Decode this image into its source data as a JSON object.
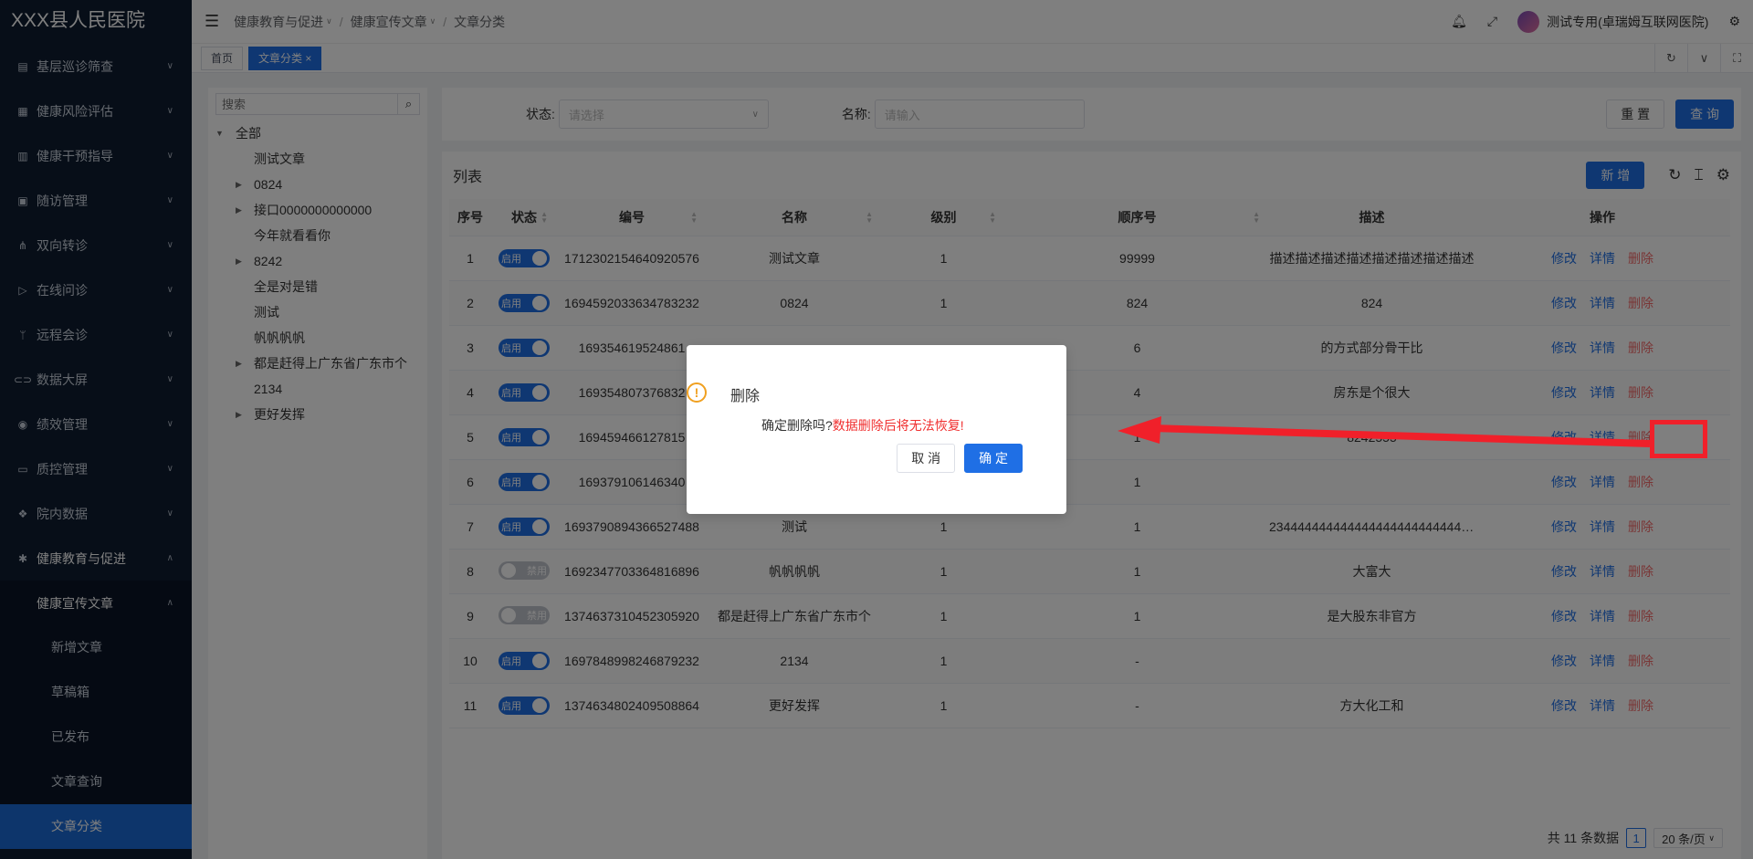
{
  "app": {
    "title": "XXX县人民医院"
  },
  "sidebar": {
    "items": [
      {
        "label": "基层巡诊筛查",
        "icon": "clipboard-icon"
      },
      {
        "label": "健康风险评估",
        "icon": "report-icon"
      },
      {
        "label": "健康干预指导",
        "icon": "grid-icon"
      },
      {
        "label": "随访管理",
        "icon": "calendar-icon"
      },
      {
        "label": "双向转诊",
        "icon": "network-icon"
      },
      {
        "label": "在线问诊",
        "icon": "send-icon"
      },
      {
        "label": "远程会诊",
        "icon": "branch-icon"
      },
      {
        "label": "数据大屏",
        "icon": "link-icon"
      },
      {
        "label": "绩效管理",
        "icon": "circle-icon"
      },
      {
        "label": "质控管理",
        "icon": "monitor-icon"
      },
      {
        "label": "院内数据",
        "icon": "dropbox-icon"
      },
      {
        "label": "健康教育与促进",
        "icon": "dots-icon"
      }
    ],
    "sub_parent": "健康宣传文章",
    "sub_items": [
      "新增文章",
      "草稿箱",
      "已发布",
      "文章查询",
      "文章分类"
    ]
  },
  "header": {
    "breadcrumb": [
      "健康教育与促进",
      "健康宣传文章",
      "文章分类"
    ],
    "user": "测试专用(卓瑞姆互联网医院)"
  },
  "tabs": [
    "首页",
    "文章分类"
  ],
  "tree": {
    "placeholder": "搜索",
    "root": "全部",
    "nodes": [
      {
        "label": "测试文章",
        "expandable": false
      },
      {
        "label": "0824",
        "expandable": true
      },
      {
        "label": "接口0000000000000",
        "expandable": true
      },
      {
        "label": "今年就看看你",
        "expandable": false
      },
      {
        "label": "8242",
        "expandable": true
      },
      {
        "label": "全是对是错",
        "expandable": false
      },
      {
        "label": "测试",
        "expandable": false
      },
      {
        "label": "帆帆帆帆",
        "expandable": false
      },
      {
        "label": "都是赶得上广东省广东市个",
        "expandable": true
      },
      {
        "label": "2134",
        "expandable": false
      },
      {
        "label": "更好发挥",
        "expandable": true
      }
    ]
  },
  "search": {
    "status_label": "状态:",
    "status_placeholder": "请选择",
    "name_label": "名称:",
    "name_placeholder": "请输入",
    "reset": "重 置",
    "query": "查 询"
  },
  "table": {
    "title": "列表",
    "add": "新 增",
    "columns": [
      "序号",
      "状态",
      "编号",
      "名称",
      "级别",
      "顺序号",
      "描述",
      "操作"
    ],
    "status_on": "启用",
    "status_off": "禁用",
    "actions": [
      "修改",
      "详情",
      "删除"
    ],
    "rows": [
      {
        "no": "1",
        "on": true,
        "code": "1712302154640920576",
        "name": "测试文章",
        "level": "1",
        "order": "99999",
        "desc": "描述描述描述描述描述描述描述描述"
      },
      {
        "no": "2",
        "on": true,
        "code": "1694592033634783232",
        "name": "0824",
        "level": "1",
        "order": "824",
        "desc": "824"
      },
      {
        "no": "3",
        "on": true,
        "code": "169354619524861",
        "name": "",
        "level": "",
        "order": "6",
        "desc": "的方式部分骨干比"
      },
      {
        "no": "4",
        "on": true,
        "code": "169354807376832",
        "name": "",
        "level": "",
        "order": "4",
        "desc": "房东是个很大"
      },
      {
        "no": "5",
        "on": true,
        "code": "169459466127815",
        "name": "",
        "level": "",
        "order": "1",
        "desc": "8242555"
      },
      {
        "no": "6",
        "on": true,
        "code": "169379106146340",
        "name": "",
        "level": "",
        "order": "1",
        "desc": ""
      },
      {
        "no": "7",
        "on": true,
        "code": "1693790894366527488",
        "name": "测试",
        "level": "1",
        "order": "1",
        "desc": "23444444444444444444444444444"
      },
      {
        "no": "8",
        "on": false,
        "code": "1692347703364816896",
        "name": "帆帆帆帆",
        "level": "1",
        "order": "1",
        "desc": "大富大"
      },
      {
        "no": "9",
        "on": false,
        "code": "1374637310452305920",
        "name": "都是赶得上广东省广东市个",
        "level": "1",
        "order": "1",
        "desc": "是大股东非官方"
      },
      {
        "no": "10",
        "on": true,
        "code": "1697848998246879232",
        "name": "2134",
        "level": "1",
        "order": "-",
        "desc": ""
      },
      {
        "no": "11",
        "on": true,
        "code": "1374634802409508864",
        "name": "更好发挥",
        "level": "1",
        "order": "-",
        "desc": "方大化工和"
      }
    ]
  },
  "pagination": {
    "total": "共 11 条数据",
    "page": "1",
    "size": "20 条/页"
  },
  "dialog": {
    "title": "删除",
    "message": "确定删除吗?",
    "warning": "数据删除后将无法恢复!",
    "cancel": "取 消",
    "confirm": "确 定"
  },
  "annotation_color": "#f0202a",
  "primary_color": "#1f6fe5"
}
